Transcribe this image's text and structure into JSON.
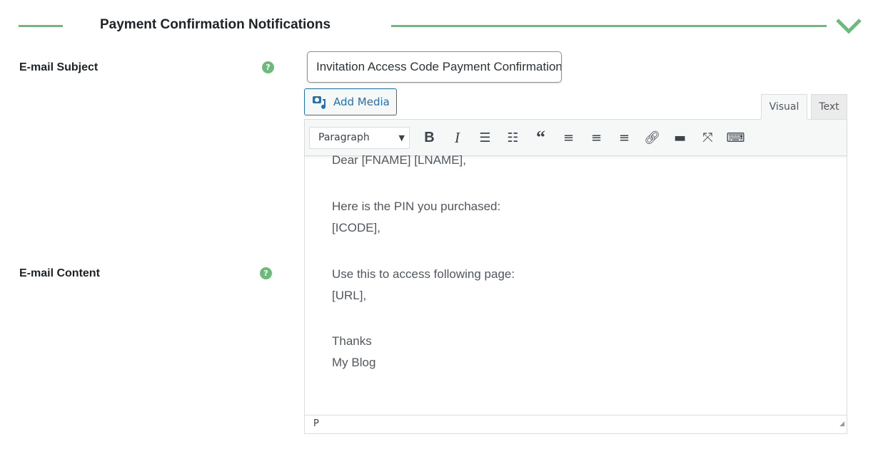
{
  "section": {
    "title": "Payment Confirmation Notifications",
    "accent": "#6dbb7a",
    "collapse_icon": "chevron-down-icon"
  },
  "subject": {
    "label": "E-mail Subject",
    "help": "?",
    "value": "Invitation Access Code Payment Confirmation"
  },
  "content": {
    "label": "E-mail Content",
    "help": "?"
  },
  "editor": {
    "add_media": "Add Media",
    "tabs": [
      "Visual",
      "Text"
    ],
    "format": "Paragraph",
    "toolbar": [
      "bold",
      "italic",
      "bulleted-list",
      "numbered-list",
      "blockquote",
      "align-left",
      "align-center",
      "align-right",
      "link",
      "read-more",
      "fullscreen",
      "toolbar-toggle"
    ],
    "lines": [
      "Dear [FNAME] [LNAME],",
      "",
      "Here is the PIN you purchased:",
      "[ICODE],",
      "",
      "Use this to access following page:",
      "[URL],",
      "",
      "Thanks",
      "My Blog"
    ],
    "status": "P"
  }
}
